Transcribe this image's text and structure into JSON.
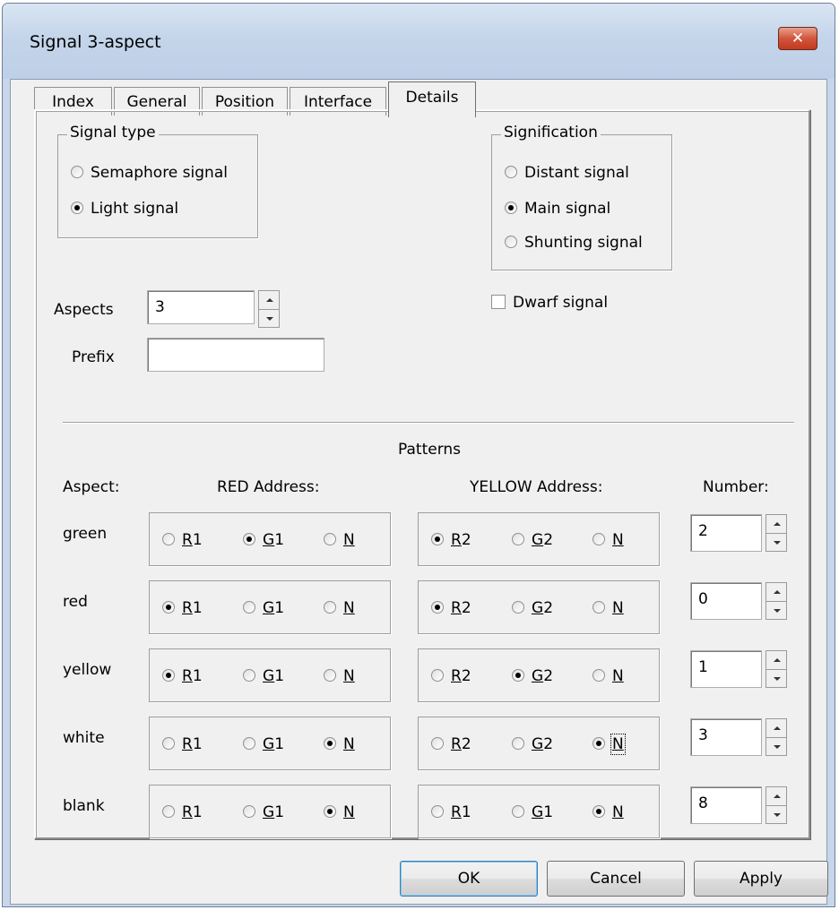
{
  "window": {
    "title": "Signal 3-aspect",
    "close_label": "✕"
  },
  "tabs": [
    {
      "label": "Index"
    },
    {
      "label": "General"
    },
    {
      "label": "Position"
    },
    {
      "label": "Interface"
    },
    {
      "label": "Details",
      "active": true
    }
  ],
  "signal_type": {
    "legend": "Signal type",
    "options": [
      {
        "label": "Semaphore signal",
        "checked": false
      },
      {
        "label": "Light signal",
        "checked": true
      }
    ]
  },
  "signification": {
    "legend": "Signification",
    "options": [
      {
        "label": "Distant signal",
        "checked": false
      },
      {
        "label": "Main signal",
        "checked": true
      },
      {
        "label": "Shunting signal",
        "checked": false
      }
    ]
  },
  "dwarf": {
    "label": "Dwarf signal",
    "checked": false
  },
  "aspects": {
    "label": "Aspects",
    "value": "3"
  },
  "prefix": {
    "label": "Prefix",
    "value": ""
  },
  "patterns": {
    "title": "Patterns",
    "headers": {
      "aspect": "Aspect:",
      "red": "RED Address:",
      "yellow": "YELLOW Address:",
      "number": "Number:"
    },
    "rows": [
      {
        "aspect": "green",
        "red": [
          {
            "u": "R",
            "rest": "1",
            "checked": false
          },
          {
            "u": "G",
            "rest": "1",
            "checked": true
          },
          {
            "u": "N",
            "rest": "",
            "checked": false
          }
        ],
        "yellow": [
          {
            "u": "R",
            "rest": "2",
            "checked": true
          },
          {
            "u": "G",
            "rest": "2",
            "checked": false
          },
          {
            "u": "N",
            "rest": "",
            "checked": false
          }
        ],
        "number": "2"
      },
      {
        "aspect": "red",
        "red": [
          {
            "u": "R",
            "rest": "1",
            "checked": true
          },
          {
            "u": "G",
            "rest": "1",
            "checked": false
          },
          {
            "u": "N",
            "rest": "",
            "checked": false
          }
        ],
        "yellow": [
          {
            "u": "R",
            "rest": "2",
            "checked": true
          },
          {
            "u": "G",
            "rest": "2",
            "checked": false
          },
          {
            "u": "N",
            "rest": "",
            "checked": false
          }
        ],
        "number": "0"
      },
      {
        "aspect": "yellow",
        "red": [
          {
            "u": "R",
            "rest": "1",
            "checked": true
          },
          {
            "u": "G",
            "rest": "1",
            "checked": false
          },
          {
            "u": "N",
            "rest": "",
            "checked": false
          }
        ],
        "yellow": [
          {
            "u": "R",
            "rest": "2",
            "checked": false
          },
          {
            "u": "G",
            "rest": "2",
            "checked": true
          },
          {
            "u": "N",
            "rest": "",
            "checked": false
          }
        ],
        "number": "1"
      },
      {
        "aspect": "white",
        "red": [
          {
            "u": "R",
            "rest": "1",
            "checked": false
          },
          {
            "u": "G",
            "rest": "1",
            "checked": false
          },
          {
            "u": "N",
            "rest": "",
            "checked": true
          }
        ],
        "yellow": [
          {
            "u": "R",
            "rest": "2",
            "checked": false
          },
          {
            "u": "G",
            "rest": "2",
            "checked": false
          },
          {
            "u": "N",
            "rest": "",
            "checked": true,
            "focused": true
          }
        ],
        "number": "3"
      },
      {
        "aspect": "blank",
        "red": [
          {
            "u": "R",
            "rest": "1",
            "checked": false
          },
          {
            "u": "G",
            "rest": "1",
            "checked": false
          },
          {
            "u": "N",
            "rest": "",
            "checked": true
          }
        ],
        "yellow": [
          {
            "u": "R",
            "rest": "1",
            "checked": false
          },
          {
            "u": "G",
            "rest": "1",
            "checked": false
          },
          {
            "u": "N",
            "rest": "",
            "checked": true
          }
        ],
        "number": "8"
      }
    ]
  },
  "buttons": {
    "ok": "OK",
    "cancel": "Cancel",
    "apply": "Apply"
  }
}
